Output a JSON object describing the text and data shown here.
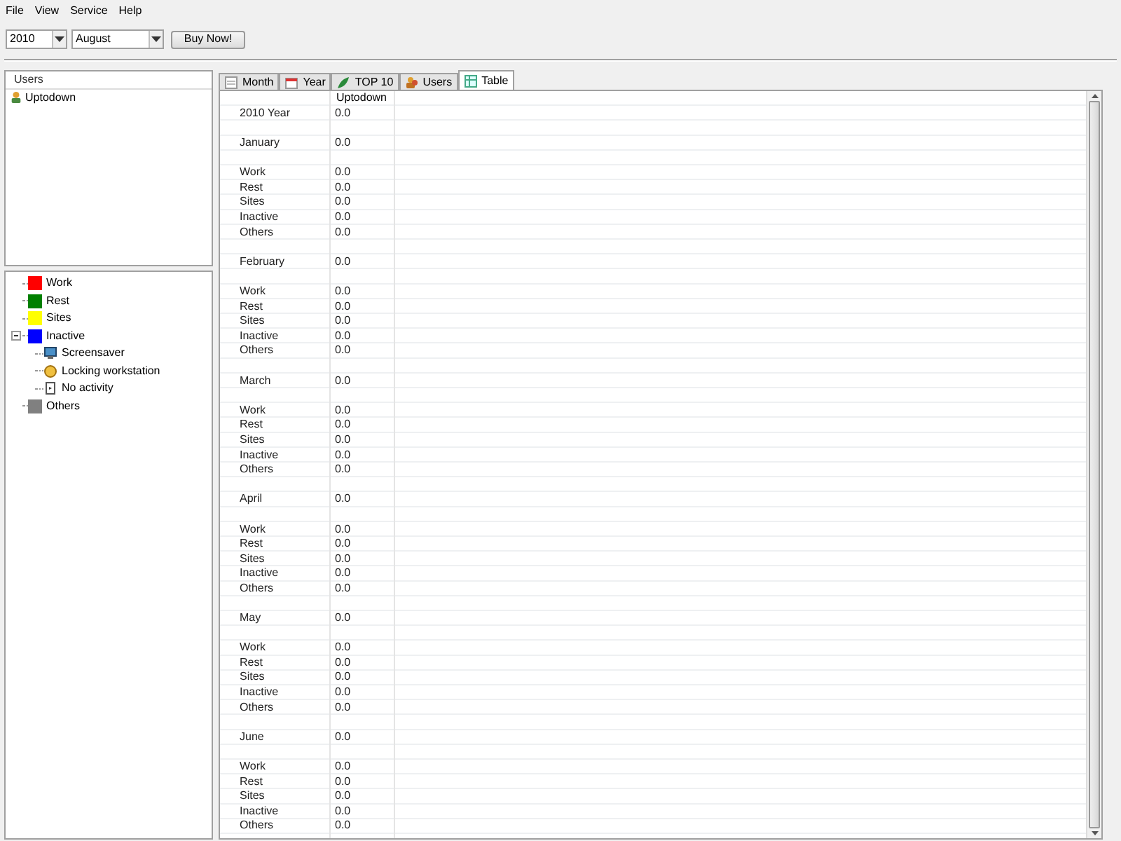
{
  "menu": [
    "File",
    "View",
    "Service",
    "Help"
  ],
  "toolbar": {
    "year": "2010",
    "month": "August",
    "buy_button": "Buy Now!"
  },
  "users_panel": {
    "header": "Users",
    "items": [
      {
        "label": "Uptodown",
        "selected": false
      }
    ]
  },
  "legend": [
    {
      "label": "Work",
      "color": "#ff0000"
    },
    {
      "label": "Rest",
      "color": "#008000"
    },
    {
      "label": "Sites",
      "color": "#ffff00"
    },
    {
      "label": "Inactive",
      "color": "#0000ff",
      "expanded": true,
      "children": [
        {
          "label": "Screensaver",
          "kind": "screen"
        },
        {
          "label": "Locking workstation",
          "kind": "lock"
        },
        {
          "label": "No activity",
          "kind": "idle"
        }
      ]
    },
    {
      "label": "Others",
      "color": "#808080"
    }
  ],
  "tabs": [
    {
      "label": "Month",
      "selected": false
    },
    {
      "label": "Year",
      "selected": false
    },
    {
      "label": "TOP 10",
      "selected": false
    },
    {
      "label": "Users",
      "selected": false
    },
    {
      "label": "Table",
      "selected": true
    }
  ],
  "table": {
    "column": "Uptodown",
    "year_row": {
      "label": "2010 Year",
      "value": "0.0"
    },
    "months": [
      {
        "label": "January",
        "value": "0.0",
        "rows": [
          {
            "label": "Work",
            "value": "0.0"
          },
          {
            "label": "Rest",
            "value": "0.0"
          },
          {
            "label": "Sites",
            "value": "0.0"
          },
          {
            "label": "Inactive",
            "value": "0.0"
          },
          {
            "label": "Others",
            "value": "0.0"
          }
        ]
      },
      {
        "label": "February",
        "value": "0.0",
        "rows": [
          {
            "label": "Work",
            "value": "0.0"
          },
          {
            "label": "Rest",
            "value": "0.0"
          },
          {
            "label": "Sites",
            "value": "0.0"
          },
          {
            "label": "Inactive",
            "value": "0.0"
          },
          {
            "label": "Others",
            "value": "0.0"
          }
        ]
      },
      {
        "label": "March",
        "value": "0.0",
        "rows": [
          {
            "label": "Work",
            "value": "0.0"
          },
          {
            "label": "Rest",
            "value": "0.0"
          },
          {
            "label": "Sites",
            "value": "0.0"
          },
          {
            "label": "Inactive",
            "value": "0.0"
          },
          {
            "label": "Others",
            "value": "0.0"
          }
        ]
      },
      {
        "label": "April",
        "value": "0.0",
        "rows": [
          {
            "label": "Work",
            "value": "0.0"
          },
          {
            "label": "Rest",
            "value": "0.0"
          },
          {
            "label": "Sites",
            "value": "0.0"
          },
          {
            "label": "Inactive",
            "value": "0.0"
          },
          {
            "label": "Others",
            "value": "0.0"
          }
        ]
      },
      {
        "label": "May",
        "value": "0.0",
        "rows": [
          {
            "label": "Work",
            "value": "0.0"
          },
          {
            "label": "Rest",
            "value": "0.0"
          },
          {
            "label": "Sites",
            "value": "0.0"
          },
          {
            "label": "Inactive",
            "value": "0.0"
          },
          {
            "label": "Others",
            "value": "0.0"
          }
        ]
      },
      {
        "label": "June",
        "value": "0.0",
        "rows": [
          {
            "label": "Work",
            "value": "0.0"
          },
          {
            "label": "Rest",
            "value": "0.0"
          },
          {
            "label": "Sites",
            "value": "0.0"
          },
          {
            "label": "Inactive",
            "value": "0.0"
          },
          {
            "label": "Others",
            "value": "0.0"
          }
        ]
      }
    ]
  }
}
